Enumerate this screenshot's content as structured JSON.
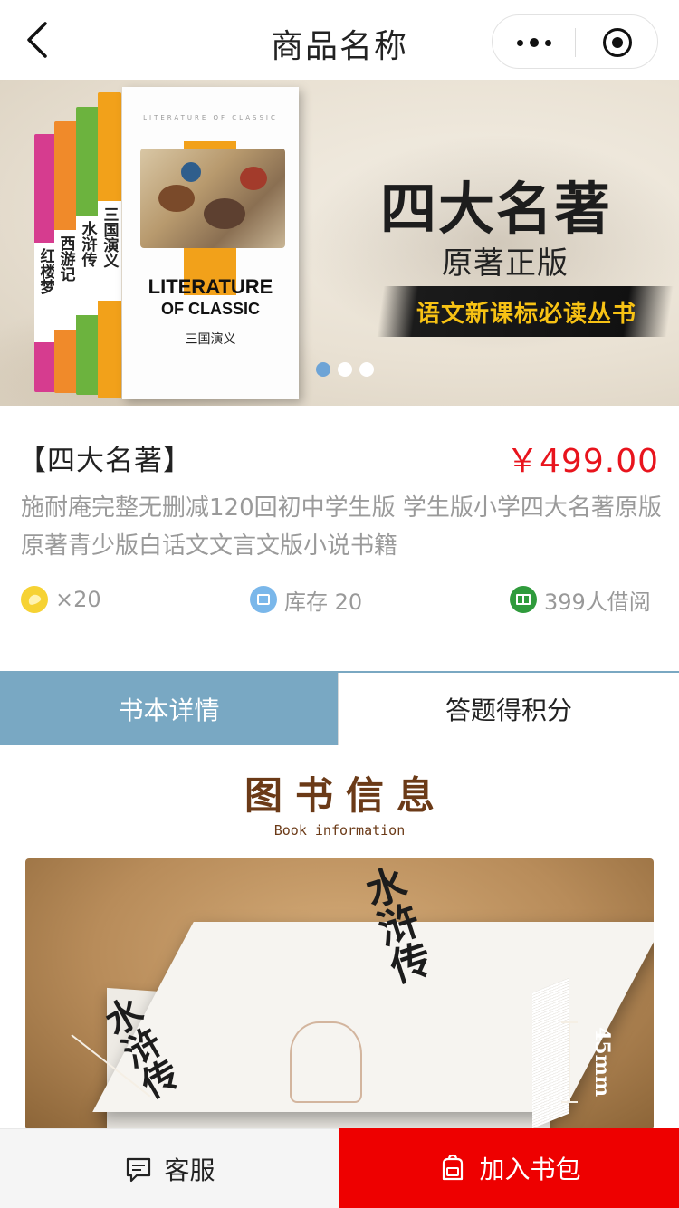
{
  "navbar": {
    "title": "商品名称",
    "back_icon": "chevron-left-icon",
    "more_icon": "more-dots-icon",
    "close_icon": "target-close-icon"
  },
  "banner": {
    "headline": "四大名著",
    "subline": "原著正版",
    "slogan": "语文新课标必读丛书",
    "book_cover": {
      "series_top": "LITERATURE OF CLASSIC",
      "title_line1": "LITERATURE",
      "title_line2": "OF CLASSIC",
      "cn_title": "三国演义"
    },
    "spines": [
      {
        "title": "红楼梦",
        "color": "#d63c8f"
      },
      {
        "title": "西游记",
        "color": "#f08a2a"
      },
      {
        "title": "水浒传",
        "color": "#6cb33e"
      },
      {
        "title": "三国演义",
        "color": "#f2a11a"
      }
    ],
    "dots_total": 3,
    "dots_active": 1
  },
  "product": {
    "name": "【四大名著】",
    "price": "￥499.00",
    "description": "施耐庵完整无删减120回初中学生版 学生版小学四大名著原版原著青少版白话文文言文版小说书籍",
    "coins": "×20",
    "stock": "库存 20",
    "borrows": "399人借阅"
  },
  "tabs": {
    "detail": "书本详情",
    "quiz": "答题得积分"
  },
  "book_info": {
    "title": "图书信息",
    "subtitle": "Book information",
    "photo": {
      "cover_text": "水浒传",
      "side_text": "水浒传",
      "measure": "45mm"
    }
  },
  "bottom": {
    "service": "客服",
    "add_to_bag": "加入书包"
  },
  "colors": {
    "price": "#e8141d",
    "tab_active": "#79a8c3",
    "cart_button": "#ee0000",
    "heading_brown": "#6b3a17"
  }
}
